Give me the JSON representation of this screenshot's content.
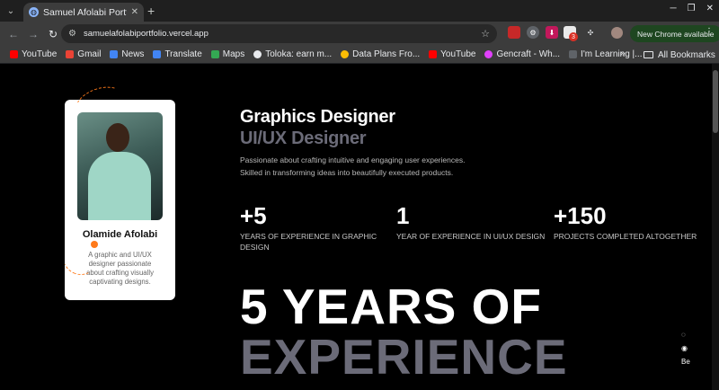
{
  "browser": {
    "tab": {
      "title": "Samuel Afolabi Portfolio",
      "close": "✕"
    },
    "new_tab": "+",
    "url": "samuelafolabiportfolio.vercel.app",
    "update_label": "New Chrome available",
    "extension_badge": "3",
    "bookmarks": [
      {
        "label": "YouTube",
        "color": "#ff0000"
      },
      {
        "label": "Gmail",
        "color": "#ea4335"
      },
      {
        "label": "News",
        "color": "#4285f4"
      },
      {
        "label": "Translate",
        "color": "#4285f4"
      },
      {
        "label": "Maps",
        "color": "#34a853"
      },
      {
        "label": "Toloka: earn m...",
        "color": "#e8eaed"
      },
      {
        "label": "Data Plans Fro...",
        "color": "#fbbc04"
      },
      {
        "label": "YouTube",
        "color": "#ff0000"
      },
      {
        "label": "Gencraft - Wh...",
        "color": "#e040fb"
      },
      {
        "label": "I'm Learning |...",
        "color": "#5f6368"
      }
    ],
    "more_bookmarks": "»",
    "all_bookmarks": "All Bookmarks"
  },
  "profile": {
    "name": "Olamide Afolabi",
    "bio": "A graphic and UI/UX designer passionate about crafting visually captivating designs."
  },
  "hero": {
    "role_primary": "Graphics Designer",
    "role_secondary": "UI/UX Designer",
    "intro_line1": "Passionate about crafting intuitive and engaging user experiences.",
    "intro_line2": "Skilled in transforming ideas into beautifully executed products."
  },
  "stats": [
    {
      "value": "+5",
      "label": "YEARS OF EXPERIENCE IN GRAPHIC DESIGN"
    },
    {
      "value": "1",
      "label": "YEAR OF EXPERIENCE IN UI/UX DESIGN"
    },
    {
      "value": "+150",
      "label": "PROJECTS COMPLETED ALTOGETHER"
    }
  ],
  "headline": {
    "line1": "5 YEARS OF",
    "line2": "EXPERIENCE"
  },
  "colors": {
    "accent": "#ff7a1a",
    "muted_heading": "#6b6b78",
    "update_pill": "#1e4620"
  }
}
